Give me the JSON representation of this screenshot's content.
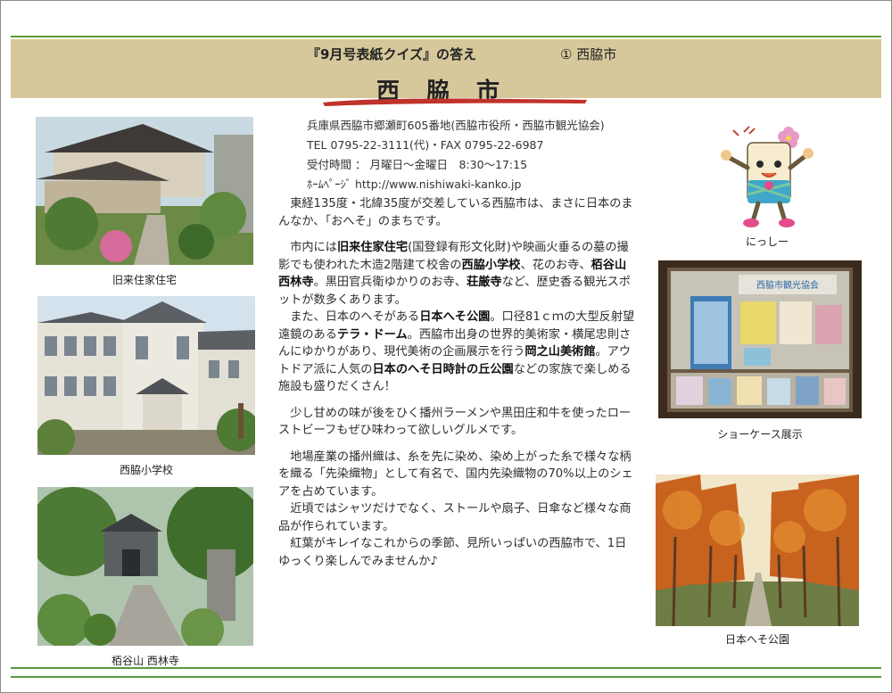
{
  "header": {
    "quiz_title": "『9月号表紙クイズ』の答え",
    "answer": "①  西脇市",
    "city": "西脇市"
  },
  "info": {
    "address": "兵庫県西脇市郷瀬町605番地(西脇市役所・西脇市観光協会)",
    "tel": "TEL 0795-22-3111(代)・FAX 0795-22-6987",
    "hours": "受付時間 ： 月曜日～金曜日　8:30～17:15",
    "homepage": "ﾎｰﾑﾍﾟｰｼﾞ  http://www.nishiwaki-kanko.jp"
  },
  "paragraphs": [
    {
      "segments": [
        {
          "t": "東経135度・北緯35度が交差している西脇市は、まさに日本のまんなか、「おへそ」のまちです。",
          "b": false
        }
      ]
    },
    {
      "segments": [
        {
          "t": "市内には",
          "b": false
        },
        {
          "t": "旧来住家住宅",
          "b": true
        },
        {
          "t": "(国登録有形文化財)や映画火垂るの墓の撮影でも使われた木造2階建て校舎の",
          "b": false
        },
        {
          "t": "西脇小学校",
          "b": true
        },
        {
          "t": "、花のお寺、",
          "b": false
        },
        {
          "t": "栢谷山西林寺",
          "b": true
        },
        {
          "t": "。黒田官兵衛ゆかりのお寺、",
          "b": false
        },
        {
          "t": "荘厳寺",
          "b": true
        },
        {
          "t": "など、歴史香る観光スポットが数多くあります。",
          "b": false
        }
      ]
    },
    {
      "segments": [
        {
          "t": "また、日本のへそがある",
          "b": false
        },
        {
          "t": "日本へそ公園",
          "b": true
        },
        {
          "t": "。口径81ｃｍの大型反射望遠鏡のある",
          "b": false
        },
        {
          "t": "テラ・ドーム",
          "b": true
        },
        {
          "t": "。西脇市出身の世界的美術家・横尾忠則さんにゆかりがあり、現代美術の企画展示を行う",
          "b": false
        },
        {
          "t": "岡之山美術館",
          "b": true
        },
        {
          "t": "。アウトドア派に人気の",
          "b": false
        },
        {
          "t": "日本のへそ日時計の丘公園",
          "b": true
        },
        {
          "t": "などの家族で楽しめる施設も盛りだくさん！",
          "b": false
        }
      ]
    },
    {
      "segments": [
        {
          "t": "少し甘めの味が後をひく播州ラーメンや黒田庄和牛を使ったローストビーフもぜひ味わって欲しいグルメです。",
          "b": false
        }
      ]
    },
    {
      "segments": [
        {
          "t": "地場産業の播州織は、糸を先に染め、染め上がった糸で様々な柄を織る「先染織物」として有名で、国内先染織物の70%以上のシェアを占めています。",
          "b": false
        }
      ]
    },
    {
      "segments": [
        {
          "t": "近頃ではシャツだけでなく、ストールや扇子、日傘など様々な商品が作られています。",
          "b": false
        }
      ]
    },
    {
      "segments": [
        {
          "t": "紅葉がキレイなこれからの季節、見所いっぱいの西脇市で、1日ゆっくり楽しんでみませんか♪",
          "b": false
        }
      ]
    }
  ],
  "captions": {
    "house": "旧来住家住宅",
    "school": "西脇小学校",
    "temple": "栢谷山 西林寺",
    "mascot": "にっしー",
    "showcase": "ショーケース展示",
    "park": "日本へそ公園"
  },
  "showcase_sign": "西脇市観光協会",
  "colors": {
    "header_bg": "#d6c89b",
    "rule_green": "#5a9a3e",
    "brush_red": "#c0322a"
  }
}
